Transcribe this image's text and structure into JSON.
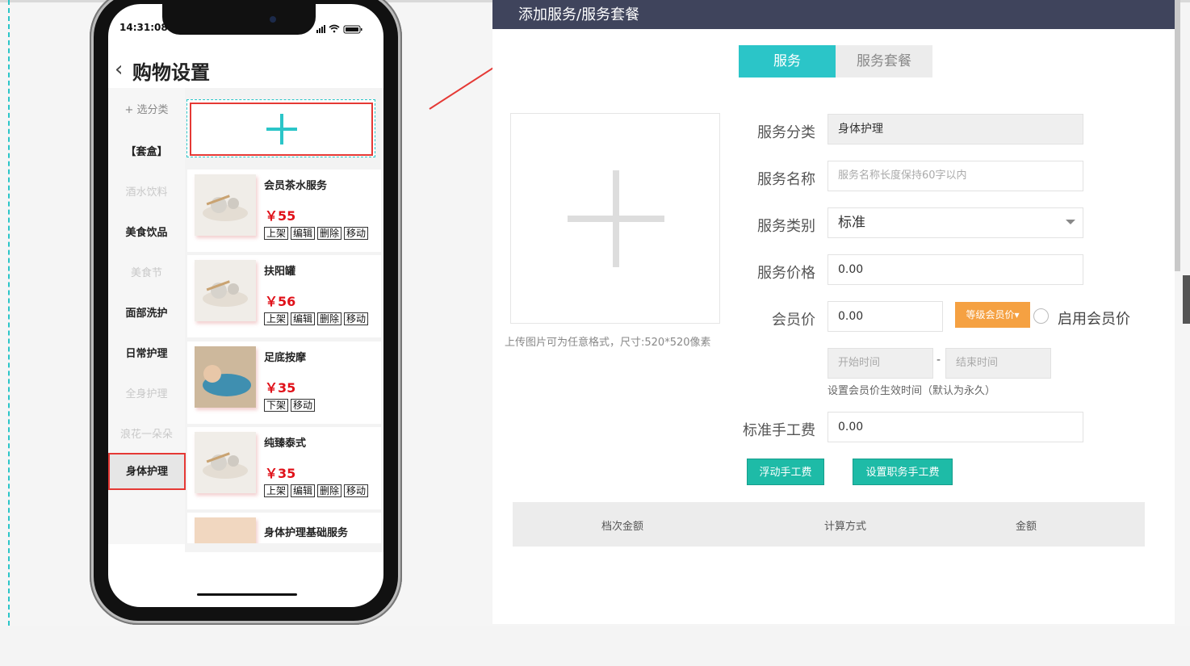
{
  "phone": {
    "status_time": "14:31:08",
    "title": "购物设置",
    "add_category": "选分类",
    "categories": [
      "【套盒】",
      "酒水饮料",
      "美食饮品",
      "美食节",
      "面部洗护",
      "日常护理",
      "全身护理",
      "浪花一朵朵",
      "身体护理"
    ],
    "products": [
      {
        "name": "会员茶水服务",
        "price": "￥55",
        "actions": [
          "上架",
          "编辑",
          "删除",
          "移动"
        ]
      },
      {
        "name": "扶阳罐",
        "price": "￥56",
        "actions": [
          "上架",
          "编辑",
          "删除",
          "移动"
        ]
      },
      {
        "name": "足底按摩",
        "price": "￥35",
        "actions": [
          "下架",
          "移动"
        ]
      },
      {
        "name": "纯臻泰式",
        "price": "￥35",
        "actions": [
          "上架",
          "编辑",
          "删除",
          "移动"
        ]
      },
      {
        "name": "身体护理基础服务",
        "price": "",
        "actions": []
      }
    ]
  },
  "panel": {
    "title": "添加服务/服务套餐",
    "tabs": [
      "服务",
      "服务套餐"
    ],
    "upload_hint": "上传图片可为任意格式，尺寸:520*520像素",
    "labels": {
      "category": "服务分类",
      "name": "服务名称",
      "type": "服务类别",
      "price": "服务价格",
      "member_price": "会员价",
      "labor_fee": "标准手工费"
    },
    "values": {
      "category": "身体护理",
      "name_placeholder": "服务名称长度保持60字以内",
      "type": "标准",
      "price": "0.00",
      "member_price": "0.00",
      "start_placeholder": "开始时间",
      "end_placeholder": "结束时间",
      "labor_fee": "0.00"
    },
    "level_price_button": "等级会员价▾",
    "enable_member_price": "启用会员价",
    "range_dash": "-",
    "validity_hint": "设置会员价生效时间（默认为永久）",
    "buttons": [
      "浮动手工费",
      "设置职务手工费"
    ],
    "table_headers": [
      "档次金额",
      "计算方式",
      "金额"
    ]
  },
  "colors": {
    "accent": "#2bc5c8",
    "header": "#3f445c",
    "price_red": "#e0121a",
    "orange": "#f5a142",
    "teal_btn": "#1ebba7",
    "highlight": "#e53935"
  }
}
